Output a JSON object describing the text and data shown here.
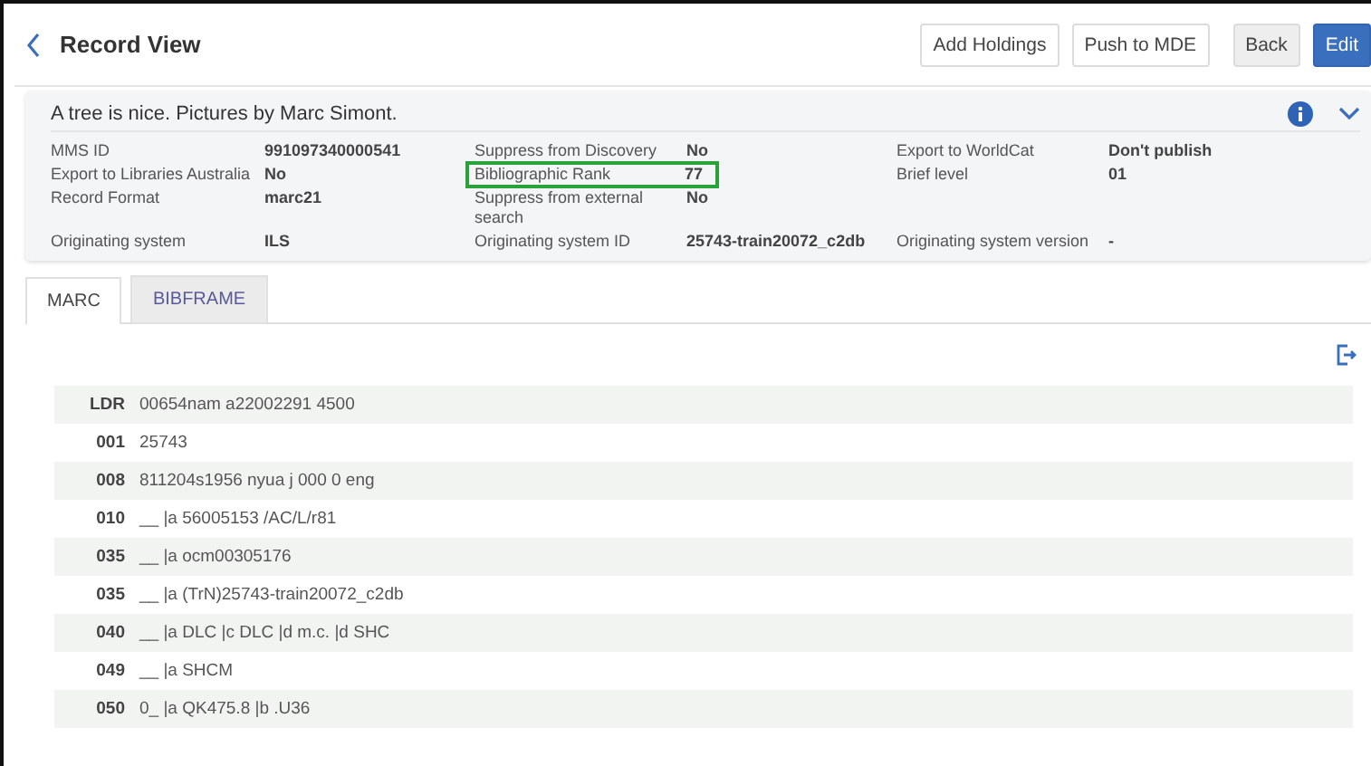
{
  "header": {
    "title": "Record View",
    "buttons": [
      {
        "label": "Add Holdings",
        "kind": "outline"
      },
      {
        "label": "Push to MDE",
        "kind": "outline"
      },
      {
        "label": "Back",
        "kind": "grey"
      },
      {
        "label": "Edit",
        "kind": "primary"
      }
    ]
  },
  "summary": {
    "title": "A tree is nice. Pictures by Marc Simont.",
    "expanded": true,
    "rows": [
      [
        {
          "label": "MMS ID",
          "value": "991097340000541"
        },
        {
          "label": "Suppress from Discovery",
          "value": "No"
        },
        {
          "label": "Export to WorldCat",
          "value": "Don't publish"
        }
      ],
      [
        {
          "label": "Export to Libraries Australia",
          "value": "No"
        },
        {
          "label": "Bibliographic Rank",
          "value": "77",
          "highlighted": true
        },
        {
          "label": "Brief level",
          "value": "01"
        }
      ],
      [
        {
          "label": "Record Format",
          "value": "marc21"
        },
        {
          "label": "Suppress from external search",
          "value": "No"
        }
      ],
      [
        {
          "label": "Originating system",
          "value": "ILS"
        },
        {
          "label": "Originating system ID",
          "value": "25743-train20072_c2db"
        },
        {
          "label": "Originating system version",
          "value": "-"
        }
      ]
    ]
  },
  "tabs": [
    {
      "label": "MARC",
      "selected": true
    },
    {
      "label": "BIBFRAME",
      "selected": false
    }
  ],
  "marc": [
    {
      "tag": "LDR",
      "value": "00654nam a22002291 4500"
    },
    {
      "tag": "001",
      "value": "25743"
    },
    {
      "tag": "008",
      "value": "811204s1956 nyua j 000 0 eng"
    },
    {
      "tag": "010",
      "value": "__ |a 56005153 /AC/L/r81"
    },
    {
      "tag": "035",
      "value": "__ |a ocm00305176"
    },
    {
      "tag": "035",
      "value": "__ |a (TrN)25743-train20072_c2db"
    },
    {
      "tag": "040",
      "value": "__ |a DLC |c DLC |d m.c. |d SHC"
    },
    {
      "tag": "049",
      "value": "__ |a SHCM"
    },
    {
      "tag": "050",
      "value": "0_ |a QK475.8 |b .U36"
    }
  ]
}
